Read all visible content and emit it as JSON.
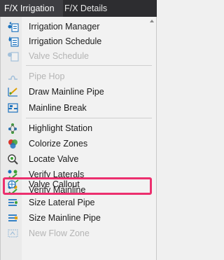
{
  "tabs": [
    {
      "label": "F/X Irrigation",
      "active": true
    },
    {
      "label": "F/X Details",
      "active": false
    }
  ],
  "menu": {
    "items": [
      {
        "label": "Irrigation Manager",
        "icon": "irrigation-manager-icon",
        "enabled": true
      },
      {
        "label": "Irrigation Schedule",
        "icon": "irrigation-schedule-icon",
        "enabled": true
      },
      {
        "label": "Valve Schedule",
        "icon": "valve-schedule-icon",
        "enabled": false
      },
      {
        "label": "Pipe Hop",
        "icon": "pipe-hop-icon",
        "enabled": false
      },
      {
        "label": "Draw Mainline Pipe",
        "icon": "draw-mainline-pipe-icon",
        "enabled": true
      },
      {
        "label": "Mainline Break",
        "icon": "mainline-break-icon",
        "enabled": true
      },
      {
        "label": "Highlight Station",
        "icon": "highlight-station-icon",
        "enabled": true
      },
      {
        "label": "Colorize Zones",
        "icon": "colorize-zones-icon",
        "enabled": true
      },
      {
        "label": "Locate Valve",
        "icon": "locate-valve-icon",
        "enabled": true
      },
      {
        "label": "Verify Laterals",
        "icon": "verify-laterals-icon",
        "enabled": true
      },
      {
        "label": "Verify Mainline",
        "icon": "verify-mainline-icon",
        "enabled": true
      },
      {
        "label": "Valve Callout",
        "icon": "valve-callout-icon",
        "enabled": true,
        "highlighted": true
      },
      {
        "label": "Size Lateral Pipe",
        "icon": "size-lateral-pipe-icon",
        "enabled": true
      },
      {
        "label": "Size Mainline Pipe",
        "icon": "size-mainline-pipe-icon",
        "enabled": true
      },
      {
        "label": "New Flow Zone",
        "icon": "new-flow-zone-icon",
        "enabled": false
      }
    ]
  },
  "colors": {
    "highlight_border": "#ec2f6e",
    "tab_bar": "#2d2d30",
    "icon_blue": "#1e73be",
    "icon_green": "#3aa035"
  }
}
